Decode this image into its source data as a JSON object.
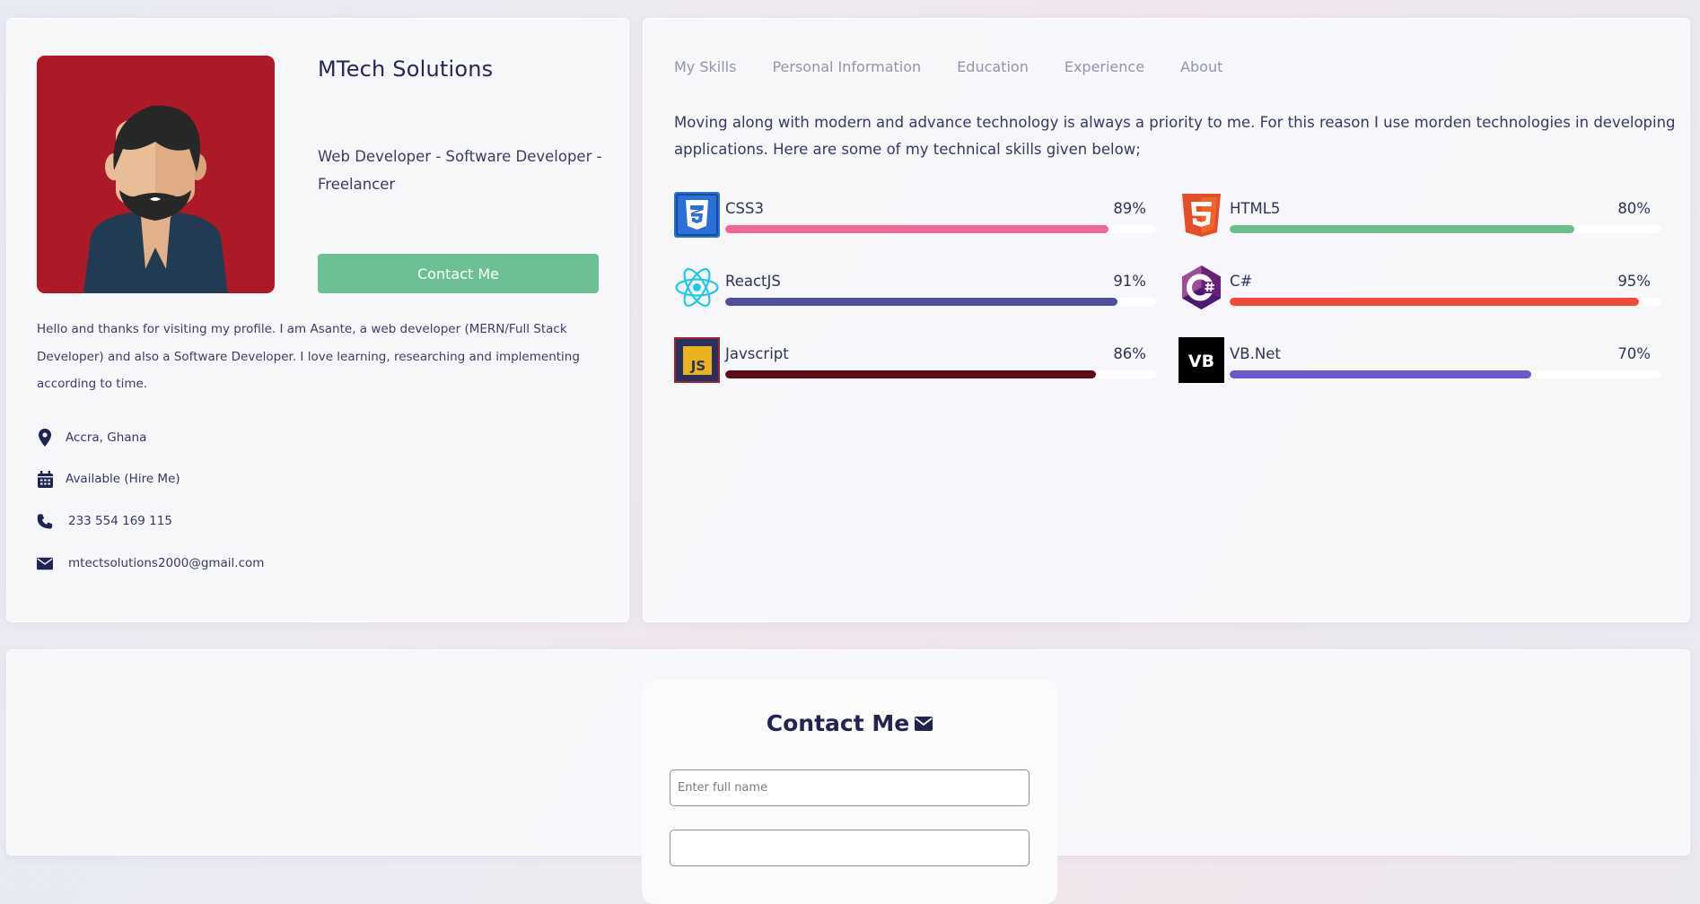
{
  "profile": {
    "company": "MTech Solutions",
    "roles": "Web Developer - Software Developer - Freelancer",
    "contact_button": "Contact Me",
    "bio": "Hello and thanks for visiting my profile. I am Asante, a web developer (MERN/Full Stack Developer) and also a Software Developer. I love learning, researching and implementing according to time.",
    "location": "Accra, Ghana",
    "availability": "Available (Hire Me)",
    "phone": "233 554 169 115",
    "email": "mtectsolutions2000@gmail.com",
    "icons": [
      "map-marker-icon",
      "calendar-icon",
      "phone-icon",
      "envelope-icon"
    ]
  },
  "tabs": [
    "My Skills",
    "Personal Information",
    "Education",
    "Experience",
    "About"
  ],
  "intro": "Moving along with modern and advance technology is always a priority to me. For this reason I use morden technologies in developing applications. Here are some of my technical skills given below;",
  "skills": [
    {
      "name": "CSS3",
      "percent_label": "89%",
      "level": 89,
      "color": "#ee6a94",
      "icon": "css3-icon"
    },
    {
      "name": "HTML5",
      "percent_label": "80%",
      "level": 80,
      "color": "#6cbe8f",
      "icon": "html5-icon"
    },
    {
      "name": "ReactJS",
      "percent_label": "91%",
      "level": 91,
      "color": "#4f4f97",
      "icon": "react-icon"
    },
    {
      "name": "C#",
      "percent_label": "95%",
      "level": 95,
      "color": "#f04a3d",
      "icon": "csharp-icon"
    },
    {
      "name": "Javscript",
      "percent_label": "86%",
      "level": 86,
      "color": "#5a0d16",
      "icon": "javascript-icon"
    },
    {
      "name": "VB.Net",
      "percent_label": "70%",
      "level": 70,
      "color": "#6a57cc",
      "icon": "vbnet-icon"
    }
  ],
  "contact_form": {
    "title": "Contact Me",
    "name_placeholder": "Enter full name"
  }
}
